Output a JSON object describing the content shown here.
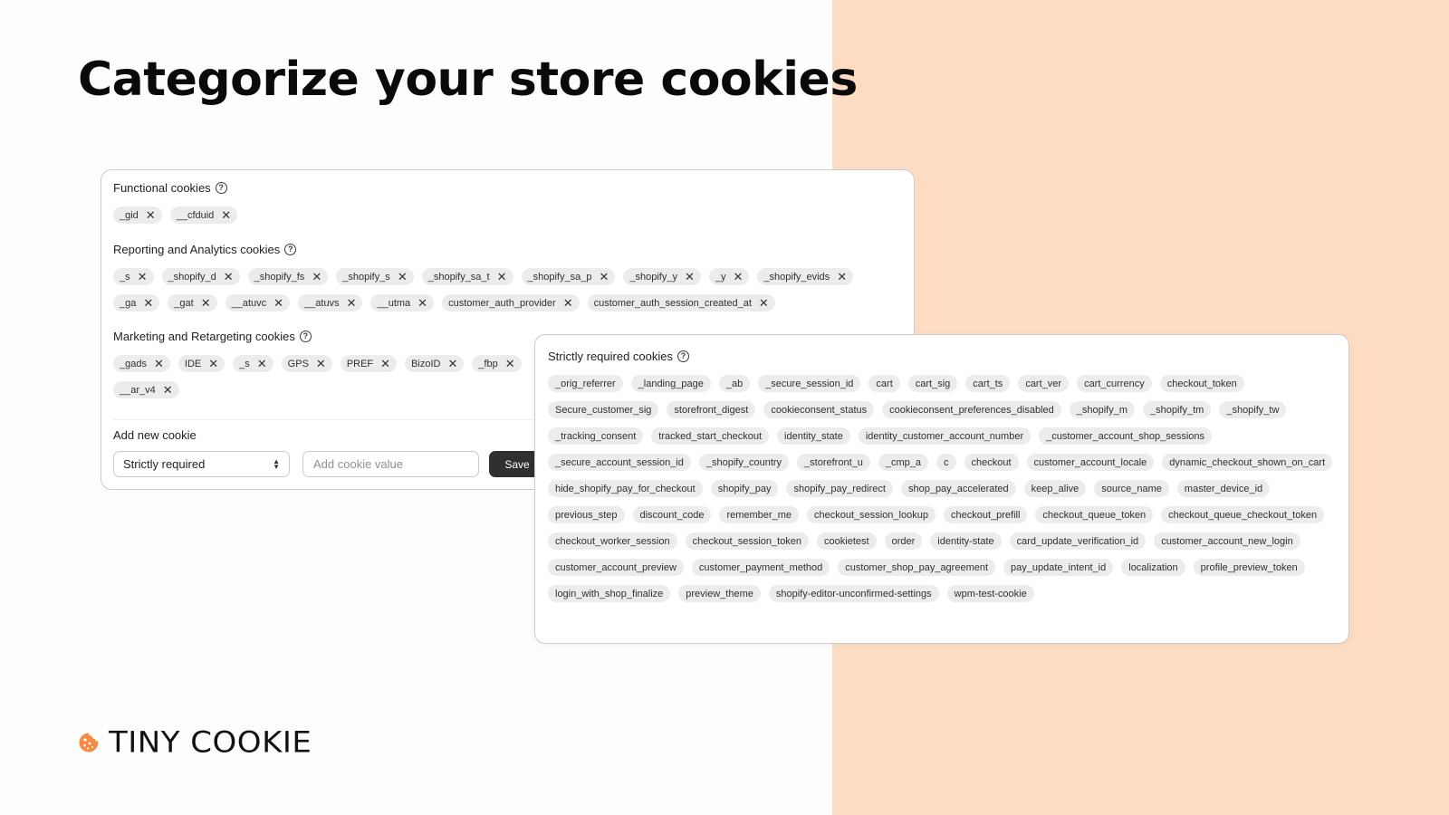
{
  "page": {
    "title": "Categorize your store cookies"
  },
  "colors": {
    "peach_background": "#fedbc3",
    "tag_background": "#ececec",
    "save_button": "#303030",
    "brand_orange": "#f58a42"
  },
  "main_panel": {
    "functional": {
      "heading": "Functional cookies",
      "tags": [
        "_gid",
        "__cfduid"
      ]
    },
    "reporting": {
      "heading": "Reporting and Analytics cookies",
      "tags": [
        "_s",
        "_shopify_d",
        "_shopify_fs",
        "_shopify_s",
        "_shopify_sa_t",
        "_shopify_sa_p",
        "_shopify_y",
        "_y",
        "_shopify_evids",
        "_ga",
        "_gat",
        "__atuvc",
        "__atuvs",
        "__utma",
        "customer_auth_provider",
        "customer_auth_session_created_at"
      ]
    },
    "marketing": {
      "heading": "Marketing and Retargeting cookies",
      "tags": [
        "_gads",
        "IDE",
        "_s",
        "GPS",
        "PREF",
        "BizoID",
        "_fbp",
        "__ar_v4"
      ]
    },
    "add_cookie": {
      "label": "Add new cookie",
      "category_selected": "Strictly required",
      "input_placeholder": "Add cookie value",
      "input_value": "",
      "save_label": "Save"
    }
  },
  "strict_panel": {
    "heading": "Strictly required cookies",
    "tags": [
      "_orig_referrer",
      "_landing_page",
      "_ab",
      "_secure_session_id",
      "cart",
      "cart_sig",
      "cart_ts",
      "cart_ver",
      "cart_currency",
      "checkout_token",
      "Secure_customer_sig",
      "storefront_digest",
      "cookieconsent_status",
      "cookieconsent_preferences_disabled",
      "_shopify_m",
      "_shopify_tm",
      "_shopify_tw",
      "_tracking_consent",
      "tracked_start_checkout",
      "identity_state",
      "identity_customer_account_number",
      "_customer_account_shop_sessions",
      "_secure_account_session_id",
      "_shopify_country",
      "_storefront_u",
      "_cmp_a",
      "c",
      "checkout",
      "customer_account_locale",
      "dynamic_checkout_shown_on_cart",
      "hide_shopify_pay_for_checkout",
      "shopify_pay",
      "shopify_pay_redirect",
      "shop_pay_accelerated",
      "keep_alive",
      "source_name",
      "master_device_id",
      "previous_step",
      "discount_code",
      "remember_me",
      "checkout_session_lookup",
      "checkout_prefill",
      "checkout_queue_token",
      "checkout_queue_checkout_token",
      "checkout_worker_session",
      "checkout_session_token",
      "cookietest",
      "order",
      "identity-state",
      "card_update_verification_id",
      "customer_account_new_login",
      "customer_account_preview",
      "customer_payment_method",
      "customer_shop_pay_agreement",
      "pay_update_intent_id",
      "localization",
      "profile_preview_token",
      "login_with_shop_finalize",
      "preview_theme",
      "shopify-editor-unconfirmed-settings",
      "wpm-test-cookie"
    ]
  },
  "brand": {
    "name": "TINY COOKIE",
    "icon": "cookie-icon"
  }
}
